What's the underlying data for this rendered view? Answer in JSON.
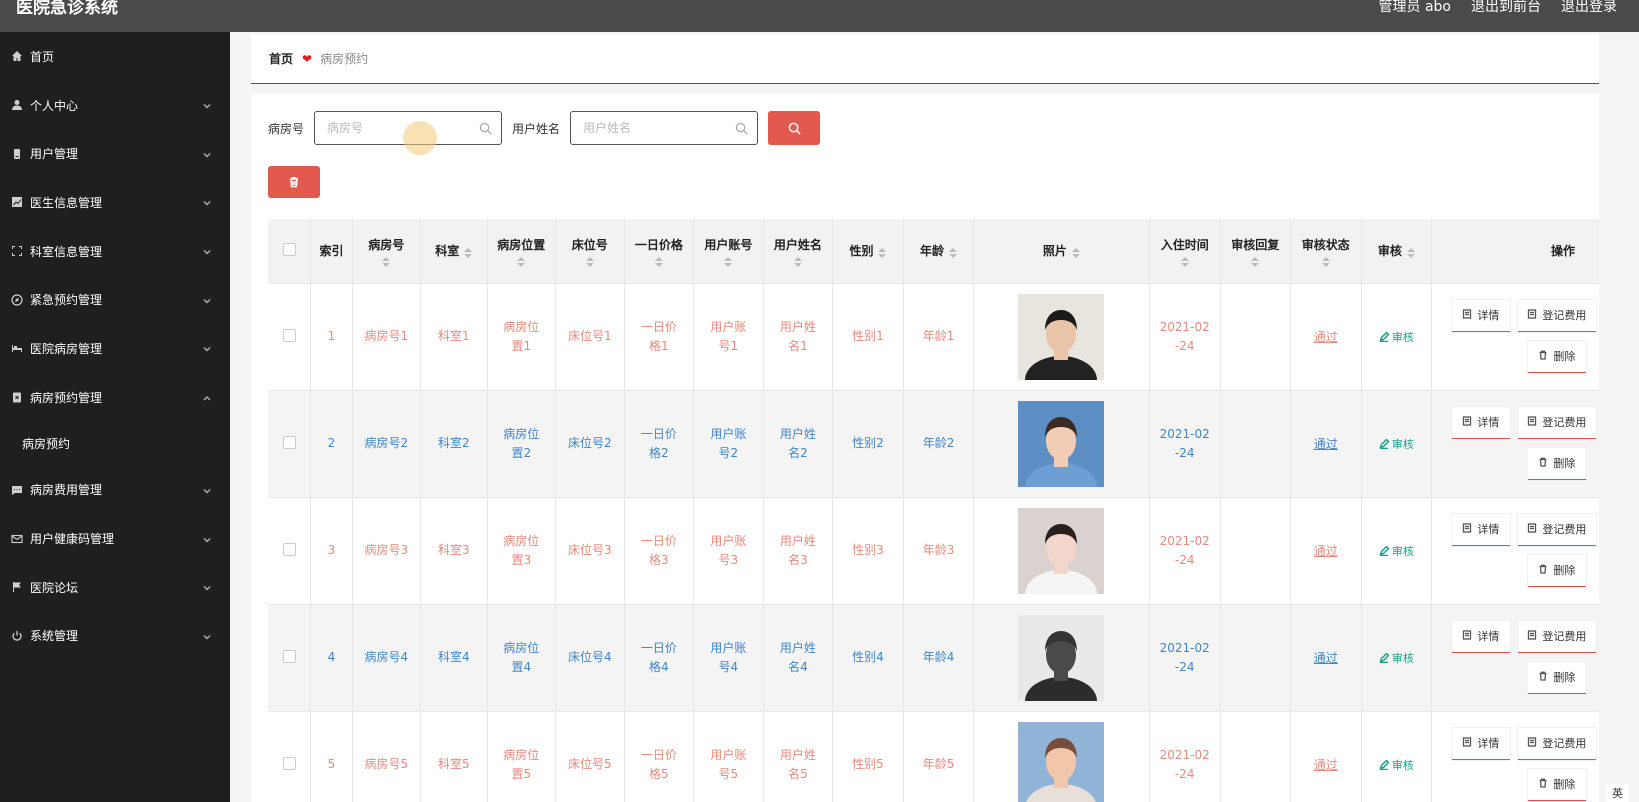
{
  "header": {
    "app_title": "医院急诊系统",
    "admin_label": "管理员 abo",
    "back_to_front": "退出到前台",
    "logout": "退出登录"
  },
  "sidebar": {
    "items": [
      {
        "label": "首页",
        "icon": "home-icon"
      },
      {
        "label": "个人中心",
        "icon": "user-icon"
      },
      {
        "label": "用户管理",
        "icon": "id-card-icon"
      },
      {
        "label": "医生信息管理",
        "icon": "chart-icon"
      },
      {
        "label": "科室信息管理",
        "icon": "frame-icon"
      },
      {
        "label": "紧急预约管理",
        "icon": "compass-icon"
      },
      {
        "label": "医院病房管理",
        "icon": "bed-icon"
      },
      {
        "label": "病房预约管理",
        "icon": "clipboard-icon"
      },
      {
        "label": "病房费用管理",
        "icon": "message-icon"
      },
      {
        "label": "用户健康码管理",
        "icon": "mail-icon"
      },
      {
        "label": "医院论坛",
        "icon": "flag-icon"
      },
      {
        "label": "系统管理",
        "icon": "power-icon"
      }
    ],
    "submenu": "病房预约"
  },
  "breadcrumb": {
    "home": "首页",
    "current": "病房预约"
  },
  "search": {
    "room_label": "病房号",
    "room_placeholder": "病房号",
    "name_label": "用户姓名",
    "name_placeholder": "用户姓名"
  },
  "table": {
    "headers": [
      "索引",
      "病房号",
      "科室",
      "病房位置",
      "床位号",
      "一日价格",
      "用户账号",
      "用户姓名",
      "性别",
      "年龄",
      "照片",
      "入住时间",
      "审核回复",
      "审核状态",
      "审核",
      "操作"
    ],
    "audit_label": "审核",
    "ops": {
      "detail": "详情",
      "fee": "登记费用",
      "delete": "删除"
    },
    "rows": [
      {
        "index": "1",
        "room": "病房号1",
        "dept": "科室1",
        "location": "病房位置1",
        "bed": "床位号1",
        "price": "一日价格1",
        "account": "用户账号1",
        "name": "用户姓名1",
        "gender": "性别1",
        "age": "年龄1",
        "checkin": "2021-02-24",
        "reply": "",
        "status": "通过",
        "color": "red"
      },
      {
        "index": "2",
        "room": "病房号2",
        "dept": "科室2",
        "location": "病房位置2",
        "bed": "床位号2",
        "price": "一日价格2",
        "account": "用户账号2",
        "name": "用户姓名2",
        "gender": "性别2",
        "age": "年龄2",
        "checkin": "2021-02-24",
        "reply": "",
        "status": "通过",
        "color": "blue"
      },
      {
        "index": "3",
        "room": "病房号3",
        "dept": "科室3",
        "location": "病房位置3",
        "bed": "床位号3",
        "price": "一日价格3",
        "account": "用户账号3",
        "name": "用户姓名3",
        "gender": "性别3",
        "age": "年龄3",
        "checkin": "2021-02-24",
        "reply": "",
        "status": "通过",
        "color": "red"
      },
      {
        "index": "4",
        "room": "病房号4",
        "dept": "科室4",
        "location": "病房位置4",
        "bed": "床位号4",
        "price": "一日价格4",
        "account": "用户账号4",
        "name": "用户姓名4",
        "gender": "性别4",
        "age": "年龄4",
        "checkin": "2021-02-24",
        "reply": "",
        "status": "通过",
        "color": "blue"
      },
      {
        "index": "5",
        "room": "病房号5",
        "dept": "科室5",
        "location": "病房位置5",
        "bed": "床位号5",
        "price": "一日价格5",
        "account": "用户账号5",
        "name": "用户姓名5",
        "gender": "性别5",
        "age": "年龄5",
        "checkin": "2021-02-24",
        "reply": "",
        "status": "通过",
        "color": "red"
      }
    ]
  },
  "ime": {
    "lang": "英"
  },
  "colors": {
    "accent": "#e25a4f",
    "row_red": "#e88a7c",
    "row_blue": "#3f86c9",
    "audit_green": "#1aa38a",
    "sidebar_bg": "#1f1f1f",
    "header_bg": "#4a4a4a"
  }
}
